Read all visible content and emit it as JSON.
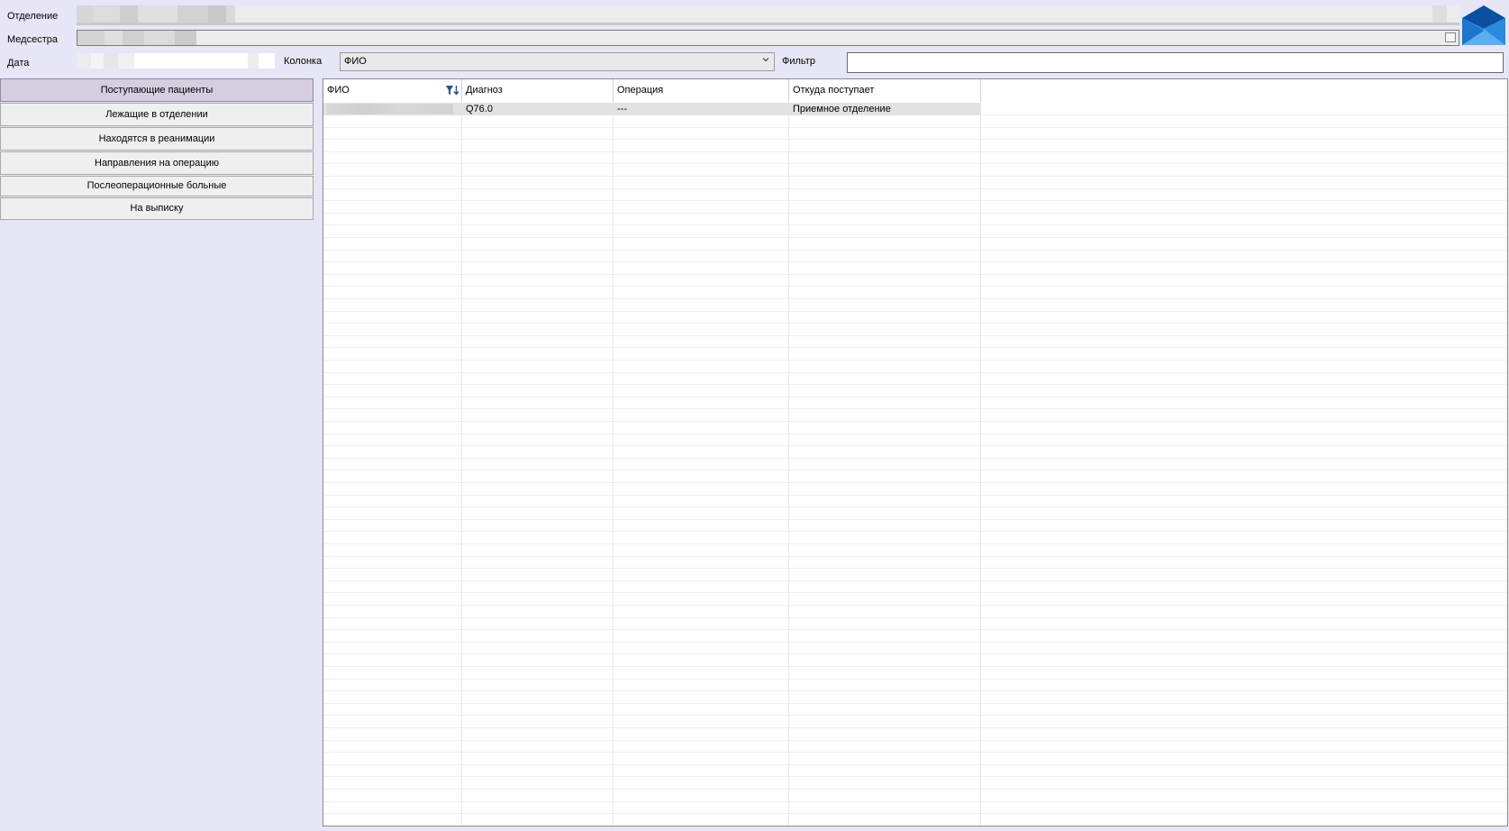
{
  "header": {
    "department_label": "Отделение",
    "nurse_label": "Медсестра",
    "date_label": "Дата",
    "column_label": "Колонка",
    "column_selected": "ФИО",
    "filter_label": "Фильтр",
    "filter_value": ""
  },
  "nav": {
    "items": [
      {
        "label": "Поступающие пациенты"
      },
      {
        "label": "Лежащие в отделении"
      },
      {
        "label": "Находятся в реанимации"
      },
      {
        "label": "Направления на операцию"
      },
      {
        "label": "Послеоперационные больные"
      },
      {
        "label": "На выписку"
      }
    ]
  },
  "grid": {
    "columns": [
      "ФИО",
      "Диагноз",
      "Операция",
      "Откуда поступает"
    ],
    "rows": [
      {
        "fio": "",
        "diagnosis": "Q76.0",
        "operation": "---",
        "source": "Приемное отделение"
      }
    ]
  },
  "colors": {
    "background": "#e6e6f7",
    "active_nav": "#d5cde0",
    "mail_icon": "#1e6fc4"
  },
  "icons": [
    "mail-icon",
    "filter-sort-icon",
    "chevron-down-icon",
    "ellipsis-icon"
  ]
}
